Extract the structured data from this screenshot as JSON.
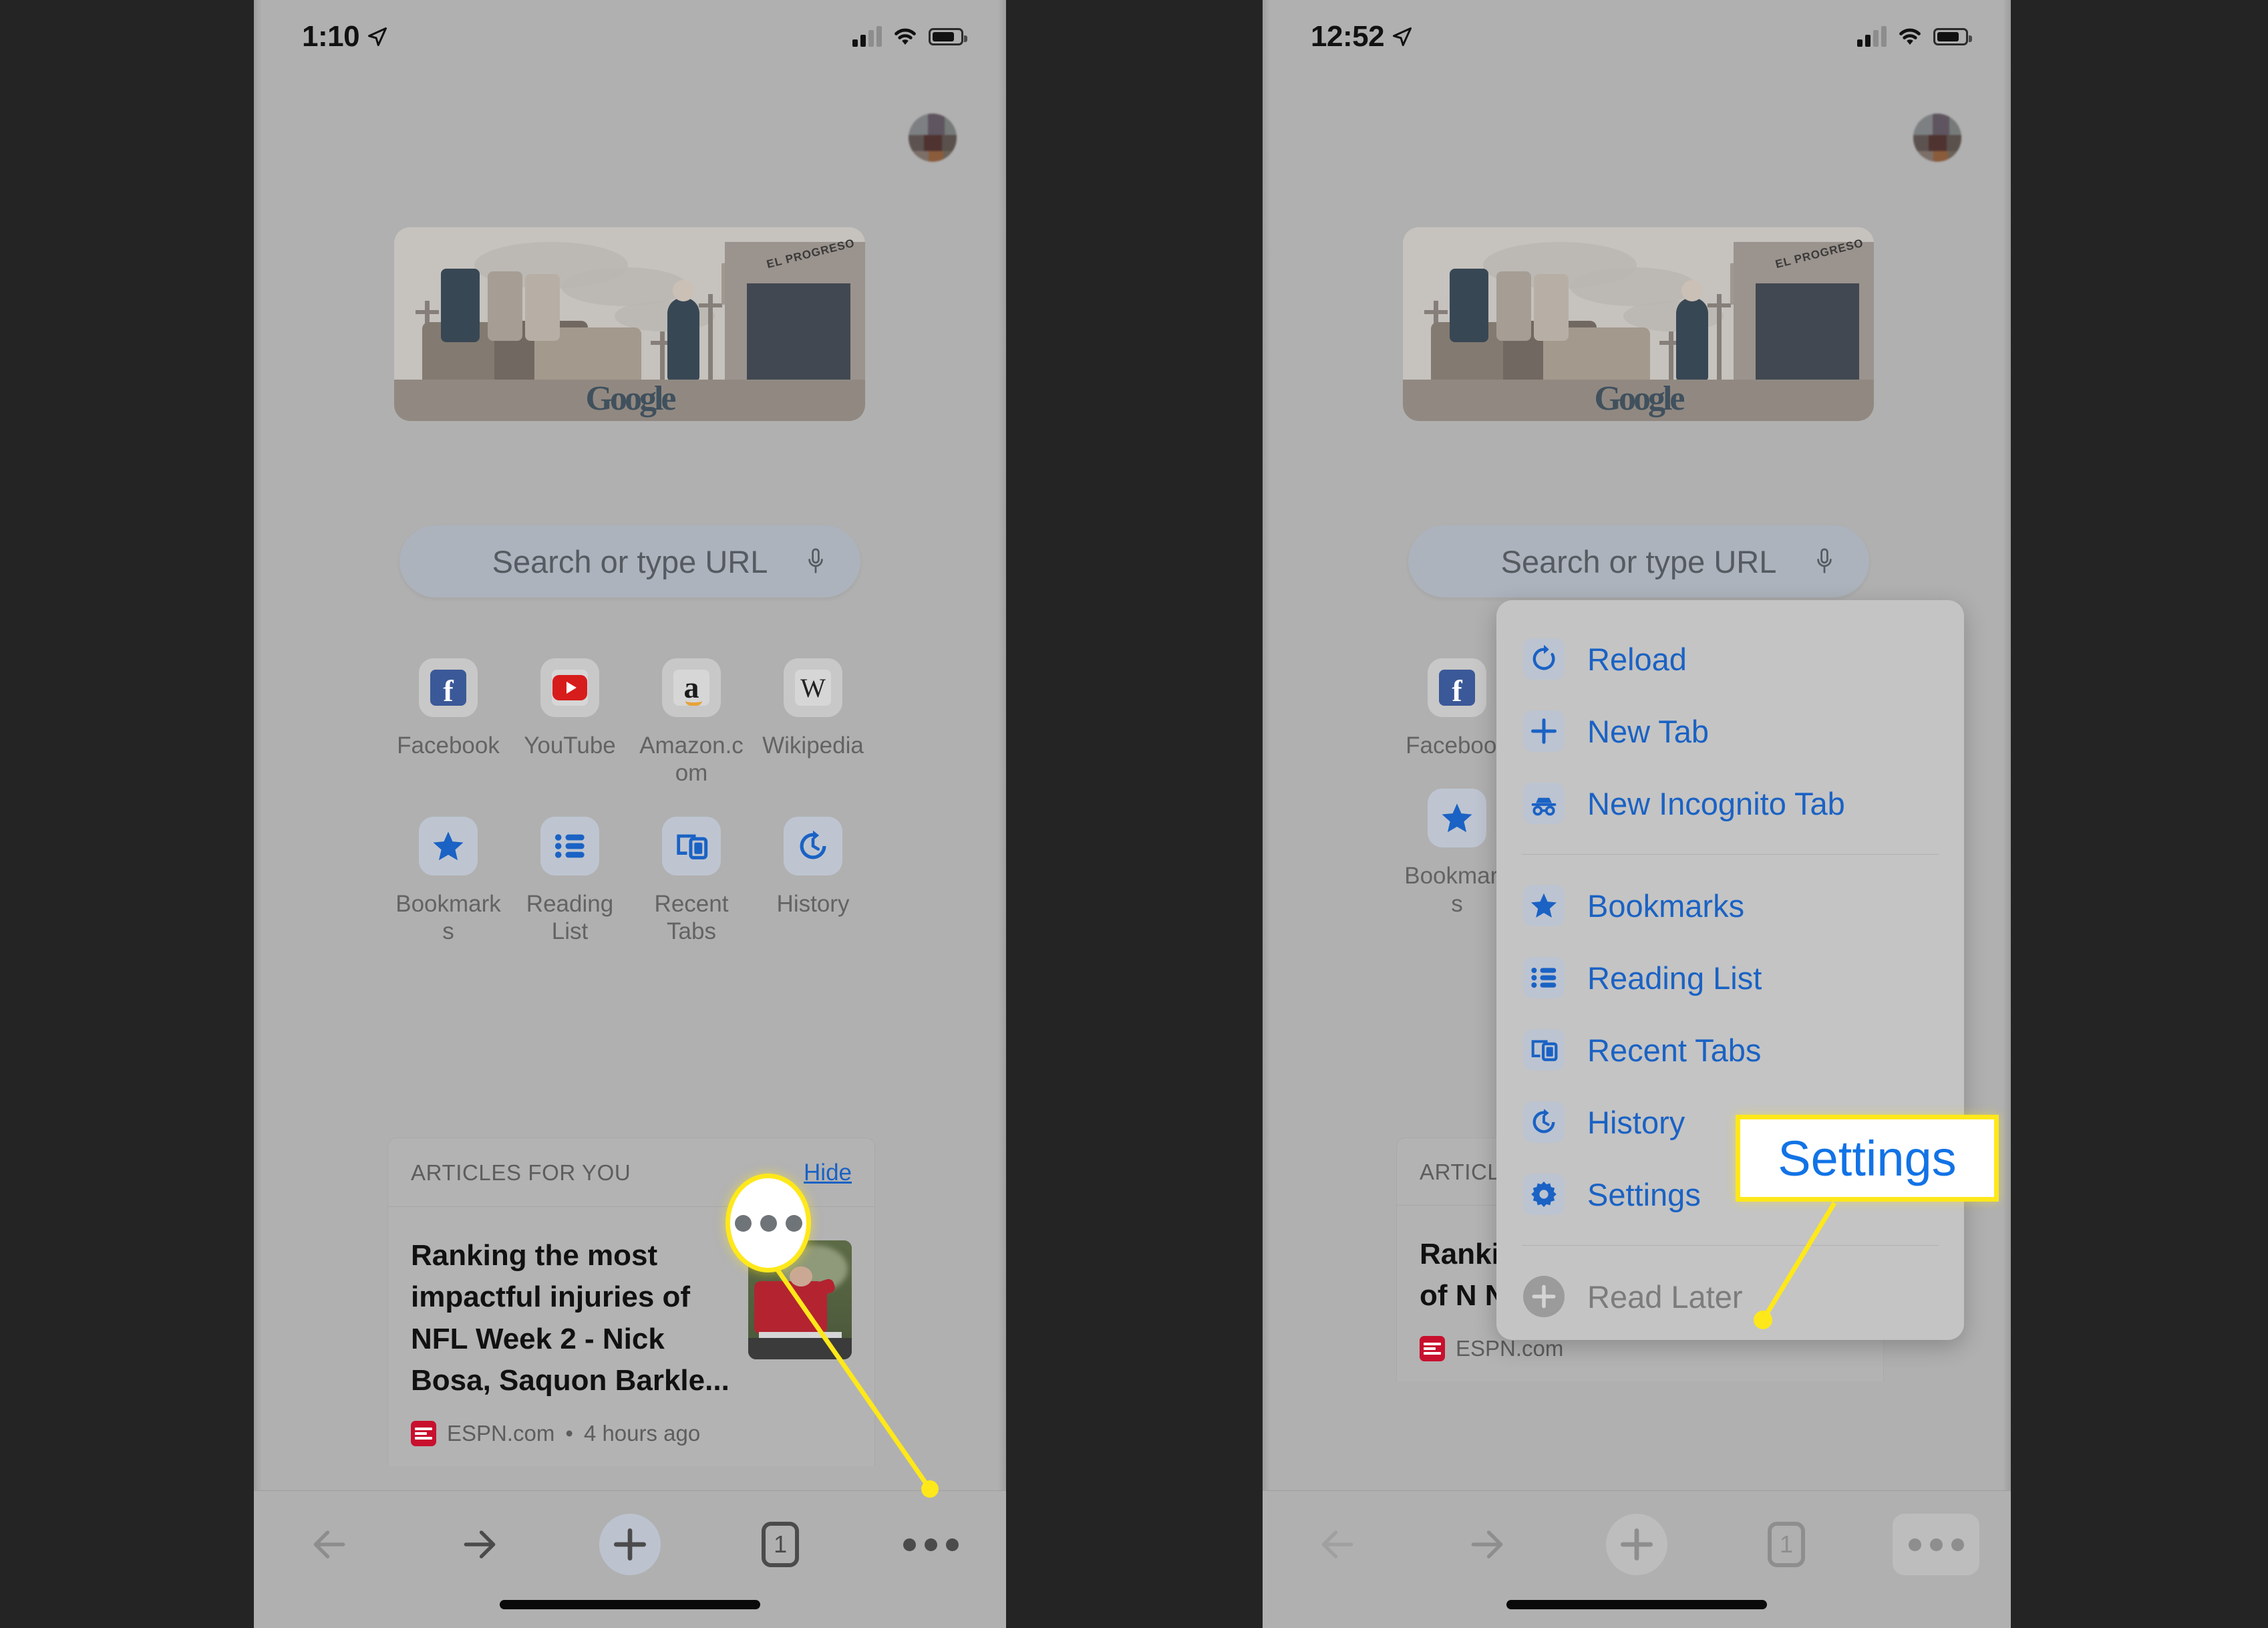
{
  "screens": [
    {
      "id": "left",
      "status": {
        "time": "1:10",
        "location_icon": "location-arrow-icon",
        "signal_icon": "cellular-signal-icon",
        "wifi_icon": "wifi-icon",
        "battery_icon": "battery-icon"
      },
      "avatar": "user-avatar",
      "doodle": {
        "name": "google-doodle",
        "sign_text": "EL PROGRESO",
        "wordmark": "Google"
      },
      "search": {
        "placeholder": "Search or type URL",
        "mic_icon": "microphone-icon"
      },
      "shortcuts": [
        {
          "label": "Facebook",
          "icon": "facebook-icon"
        },
        {
          "label": "YouTube",
          "icon": "youtube-icon"
        },
        {
          "label": "Amazon.com",
          "icon": "amazon-icon"
        },
        {
          "label": "Wikipedia",
          "icon": "wikipedia-icon"
        }
      ],
      "actions": [
        {
          "label": "Bookmarks",
          "icon": "star-icon"
        },
        {
          "label": "Reading List",
          "icon": "list-icon"
        },
        {
          "label": "Recent Tabs",
          "icon": "devices-icon"
        },
        {
          "label": "History",
          "icon": "history-clock-icon"
        }
      ],
      "articles": {
        "header": "ARTICLES FOR YOU",
        "hide_label": "Hide",
        "items": [
          {
            "title": "Ranking the most impactful injuries of NFL Week 2 - Nick Bosa, Saquon Barkle...",
            "source": "ESPN.com",
            "time": "4 hours ago",
            "separator": "•"
          }
        ]
      },
      "toolbar": {
        "back": "back-arrow",
        "forward": "forward-arrow",
        "new_tab": "plus",
        "tab_count": "1",
        "more": "three-dots"
      }
    },
    {
      "id": "right",
      "status": {
        "time": "12:52",
        "location_icon": "location-arrow-icon",
        "signal_icon": "cellular-signal-icon",
        "wifi_icon": "wifi-icon",
        "battery_icon": "battery-icon"
      },
      "avatar": "user-avatar",
      "doodle": {
        "name": "google-doodle",
        "sign_text": "EL PROGRESO",
        "wordmark": "Google"
      },
      "search": {
        "placeholder": "Search or type URL",
        "mic_icon": "microphone-icon"
      },
      "shortcuts": [
        {
          "label": "Facebook",
          "icon": "facebook-icon"
        }
      ],
      "actions": [
        {
          "label": "Bookmarks",
          "icon": "star-icon"
        }
      ],
      "articles": {
        "header": "ARTICLES FO",
        "items": [
          {
            "title": "Ranking the injuries of N Nick Bosa,",
            "source": "ESPN.com"
          }
        ]
      },
      "toolbar": {
        "back": "back-arrow",
        "forward": "forward-arrow",
        "new_tab": "plus",
        "tab_count": "1",
        "more": "three-dots"
      },
      "menu": {
        "group1": [
          {
            "label": "Reload",
            "icon": "reload-icon",
            "enabled": true
          },
          {
            "label": "New Tab",
            "icon": "plus-icon",
            "enabled": true
          },
          {
            "label": "New Incognito Tab",
            "icon": "incognito-icon",
            "enabled": true
          }
        ],
        "group2": [
          {
            "label": "Bookmarks",
            "icon": "star-icon",
            "enabled": true
          },
          {
            "label": "Reading List",
            "icon": "list-icon",
            "enabled": true
          },
          {
            "label": "Recent Tabs",
            "icon": "devices-icon",
            "enabled": true
          },
          {
            "label": "History",
            "icon": "history-clock-icon",
            "enabled": true
          },
          {
            "label": "Settings",
            "icon": "gear-icon",
            "enabled": true
          }
        ],
        "group3": [
          {
            "label": "Read Later",
            "icon": "read-later-icon",
            "enabled": false
          }
        ]
      }
    }
  ],
  "annotations": {
    "callout_label": "Settings",
    "highlight_icon": "three-dots",
    "accent_color": "#ffe81a",
    "link_color": "#1a62c4",
    "callout_text_color": "#1273e6"
  }
}
